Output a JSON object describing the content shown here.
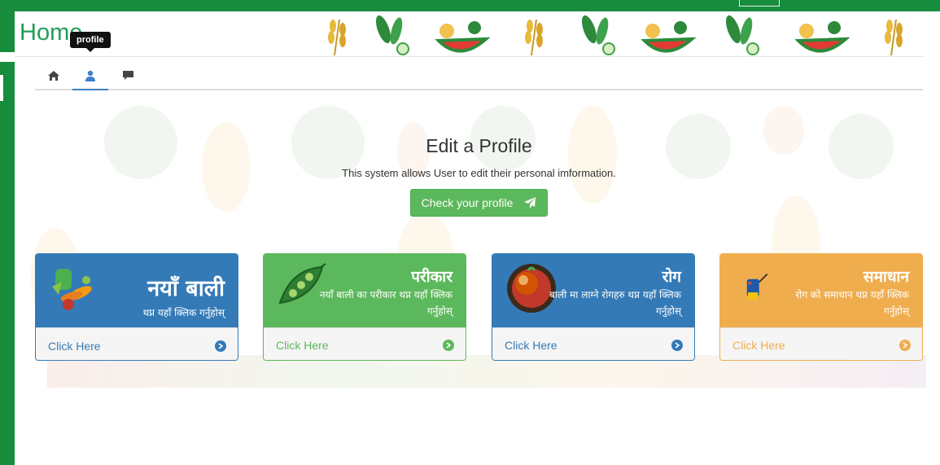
{
  "header": {
    "title": "Home",
    "tooltip": "profile"
  },
  "nav": {
    "tabs": [
      {
        "name": "home",
        "icon": "home-icon"
      },
      {
        "name": "profile",
        "icon": "user-icon",
        "active": true
      },
      {
        "name": "messages",
        "icon": "comment-icon"
      }
    ]
  },
  "hero": {
    "title": "Edit a Profile",
    "subtitle": "This system allows User to edit their personal imformation.",
    "button_label": "Check your profile",
    "button_icon": "paper-plane-icon"
  },
  "panels": [
    {
      "title": "नयाँ बाली",
      "desc": "थप्न यहाँ क्लिक गर्नुहोस्",
      "link": "Click Here",
      "color": "#337ab7",
      "icon": "vegetables-icon"
    },
    {
      "title": "परीकार",
      "desc": "नयाँ बाली का परीकार थप्न यहाँ क्लिक गर्नुहोस्",
      "link": "Click Here",
      "color": "#5cb85c",
      "icon": "pea-pod-icon"
    },
    {
      "title": "रोग",
      "desc": "बाली मा लाग्ने रोगहरु थप्न यहाँ क्लिक गर्नुहोस्",
      "link": "Click Here",
      "color": "#337ab7",
      "icon": "diseased-tomato-icon"
    },
    {
      "title": "समाधान",
      "desc": "रोग को समाधान थप्न यहाँ क्लिक गर्नुहोस्",
      "link": "Click Here",
      "color": "#f0ad4e",
      "icon": "sprayer-icon"
    }
  ],
  "colors": {
    "chrome": "#178c3d",
    "title_green": "#1f9d55",
    "tab_active": "#3d7fc8"
  }
}
